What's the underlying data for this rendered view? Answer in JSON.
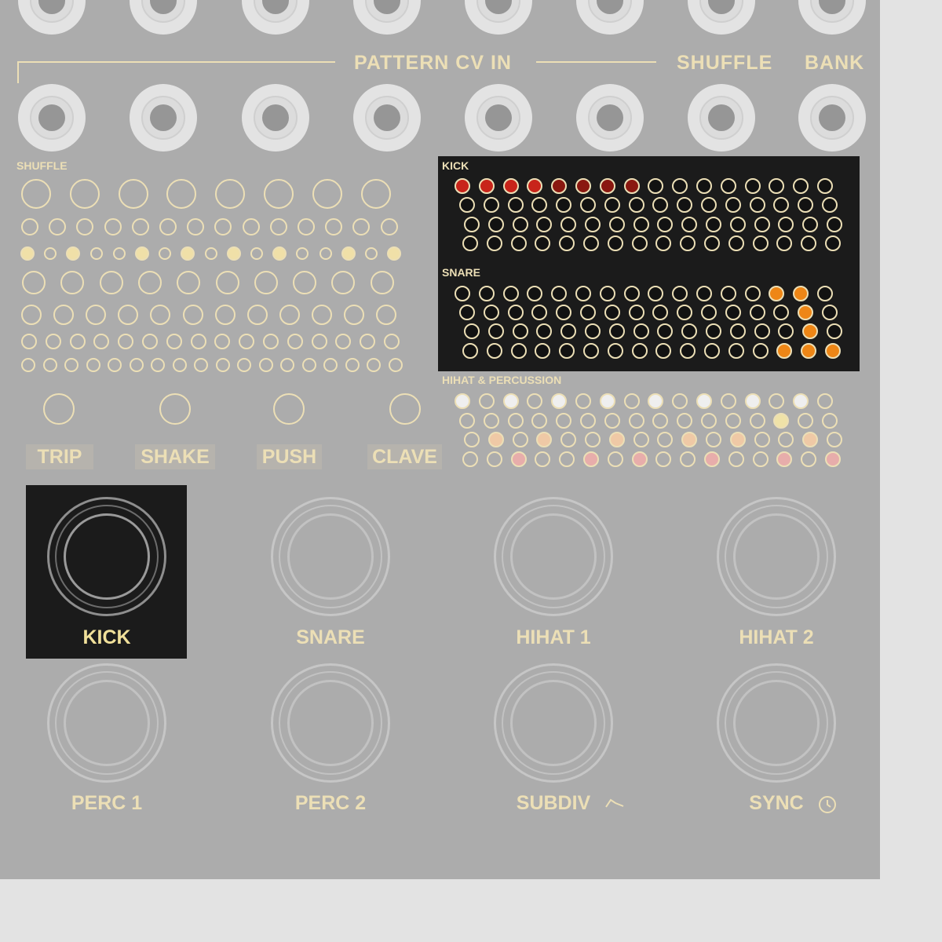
{
  "header": {
    "pattern_cv_in": "PATTERN CV IN",
    "shuffle": "SHUFFLE",
    "bank": "BANK"
  },
  "shuffle_section": {
    "label": "SHUFFLE",
    "buttons": [
      {
        "label": "TRIP"
      },
      {
        "label": "SHAKE"
      },
      {
        "label": "PUSH"
      },
      {
        "label": "CLAVE"
      }
    ]
  },
  "sequencer": {
    "kick_label": "KICK",
    "snare_label": "SNARE",
    "hihat_label": "HIHAT & PERCUSSION",
    "kick_rows": [
      [
        2,
        2,
        2,
        2,
        1,
        1,
        1,
        1,
        0,
        0,
        0,
        0,
        0,
        0,
        0,
        0
      ],
      [
        0,
        0,
        0,
        0,
        0,
        0,
        0,
        0,
        0,
        0,
        0,
        0,
        0,
        0,
        0,
        0
      ],
      [
        0,
        0,
        0,
        0,
        0,
        0,
        0,
        0,
        0,
        0,
        0,
        0,
        0,
        0,
        0,
        0
      ],
      [
        0,
        0,
        0,
        0,
        0,
        0,
        0,
        0,
        0,
        0,
        0,
        0,
        0,
        0,
        0,
        0
      ]
    ],
    "snare_rows": [
      [
        0,
        0,
        0,
        0,
        0,
        0,
        0,
        0,
        0,
        0,
        0,
        0,
        0,
        3,
        3,
        0
      ],
      [
        0,
        0,
        0,
        0,
        0,
        0,
        0,
        0,
        0,
        0,
        0,
        0,
        0,
        0,
        3,
        0
      ],
      [
        0,
        0,
        0,
        0,
        0,
        0,
        0,
        0,
        0,
        0,
        0,
        0,
        0,
        0,
        3,
        0
      ],
      [
        0,
        0,
        0,
        0,
        0,
        0,
        0,
        0,
        0,
        0,
        0,
        0,
        0,
        3,
        3,
        3
      ]
    ],
    "hihat_rows": [
      [
        1,
        0,
        1,
        0,
        1,
        0,
        1,
        0,
        1,
        0,
        1,
        0,
        1,
        0,
        1,
        0
      ],
      [
        0,
        0,
        0,
        0,
        0,
        0,
        0,
        0,
        0,
        0,
        0,
        0,
        0,
        2,
        0,
        0
      ],
      [
        0,
        1,
        0,
        1,
        0,
        0,
        1,
        0,
        0,
        1,
        0,
        1,
        0,
        0,
        1,
        0
      ],
      [
        0,
        0,
        1,
        0,
        0,
        1,
        0,
        1,
        0,
        0,
        1,
        0,
        0,
        1,
        0,
        1
      ]
    ]
  },
  "outputs": [
    {
      "label": "KICK",
      "selected": true
    },
    {
      "label": "SNARE",
      "selected": false
    },
    {
      "label": "HIHAT 1",
      "selected": false
    },
    {
      "label": "HIHAT 2",
      "selected": false
    },
    {
      "label": "PERC 1",
      "selected": false
    },
    {
      "label": "PERC 2",
      "selected": false
    },
    {
      "label": "SUBDIV",
      "selected": false,
      "icon": "ramp-wave-icon"
    },
    {
      "label": "SYNC",
      "selected": false,
      "icon": "clock-icon"
    }
  ],
  "colors": {
    "panel": "#acacac",
    "cream": "#ecdfb6",
    "kick_active": "#c8241a",
    "kick_dim": "#8a1810",
    "snare_active": "#ee8616",
    "hihat_white": "#efefef",
    "hihat_peach": "#efc9a6",
    "hihat_pink": "#e7adab"
  }
}
